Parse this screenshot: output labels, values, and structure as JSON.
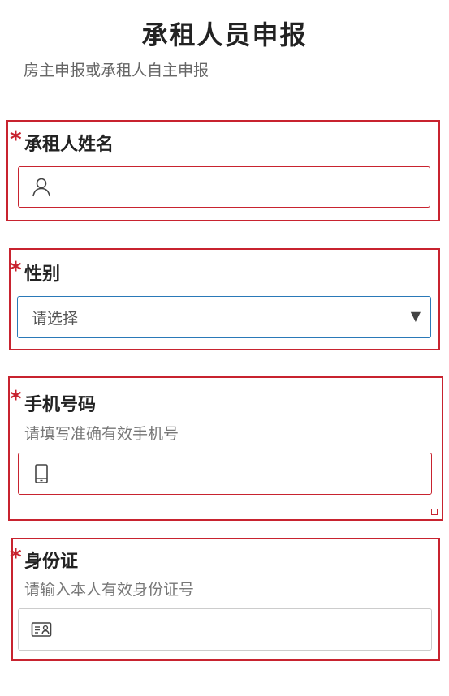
{
  "header": {
    "title": "承租人员申报",
    "subtitle": "房主申报或承租人自主申报"
  },
  "colors": {
    "required": "#c8232f",
    "focus_border": "#2a79b8",
    "error_border": "#c8232f"
  },
  "fields": [
    {
      "required_mark": "*",
      "label": "承租人姓名",
      "hint": "",
      "icon": "person-icon",
      "value": "",
      "placeholder": ""
    },
    {
      "required_mark": "*",
      "label": "性别",
      "hint": "",
      "icon": "chevron-down-icon",
      "selected": "请选择",
      "arrow": "▼"
    },
    {
      "required_mark": "*",
      "label": "手机号码",
      "hint": "请填写准确有效手机号",
      "icon": "mobile-phone-icon",
      "value": "",
      "placeholder": ""
    },
    {
      "required_mark": "*",
      "label": "身份证",
      "hint": "请输入本人有效身份证号",
      "icon": "id-card-icon",
      "value": "",
      "placeholder": ""
    }
  ]
}
